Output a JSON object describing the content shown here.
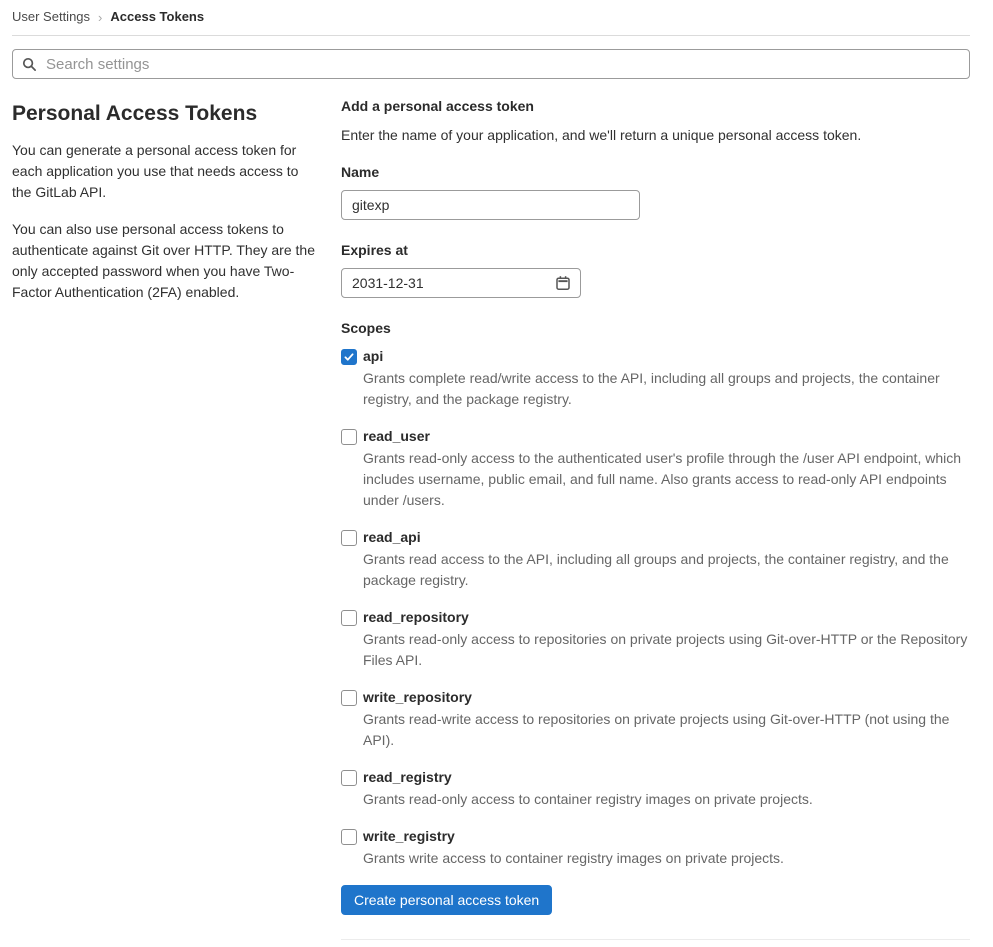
{
  "breadcrumb": {
    "parent": "User Settings",
    "current": "Access Tokens"
  },
  "search": {
    "placeholder": "Search settings"
  },
  "sidebar": {
    "title": "Personal Access Tokens",
    "paragraphs": [
      "You can generate a personal access token for each application you use that needs access to the GitLab API.",
      "You can also use personal access tokens to authenticate against Git over HTTP. They are the only accepted password when you have Two-Factor Authentication (2FA) enabled."
    ]
  },
  "form": {
    "title": "Add a personal access token",
    "description": "Enter the name of your application, and we'll return a unique personal access token.",
    "name_label": "Name",
    "name_value": "gitexp",
    "expires_label": "Expires at",
    "expires_value": "2031-12-31",
    "scopes_label": "Scopes",
    "scopes": [
      {
        "name": "api",
        "checked": true,
        "description": "Grants complete read/write access to the API, including all groups and projects, the container registry, and the package registry."
      },
      {
        "name": "read_user",
        "checked": false,
        "description": "Grants read-only access to the authenticated user's profile through the /user API endpoint, which includes username, public email, and full name. Also grants access to read-only API endpoints under /users."
      },
      {
        "name": "read_api",
        "checked": false,
        "description": "Grants read access to the API, including all groups and projects, the container registry, and the package registry."
      },
      {
        "name": "read_repository",
        "checked": false,
        "description": "Grants read-only access to repositories on private projects using Git-over-HTTP or the Repository Files API."
      },
      {
        "name": "write_repository",
        "checked": false,
        "description": "Grants read-write access to repositories on private projects using Git-over-HTTP (not using the API)."
      },
      {
        "name": "read_registry",
        "checked": false,
        "description": "Grants read-only access to container registry images on private projects."
      },
      {
        "name": "write_registry",
        "checked": false,
        "description": "Grants write access to container registry images on private projects."
      }
    ],
    "submit_label": "Create personal access token"
  },
  "colors": {
    "accent": "#1f75cb",
    "text": "#303030",
    "secondary_text": "#666666",
    "input_border": "#9b9b9b",
    "divider": "#dbdbdb"
  }
}
